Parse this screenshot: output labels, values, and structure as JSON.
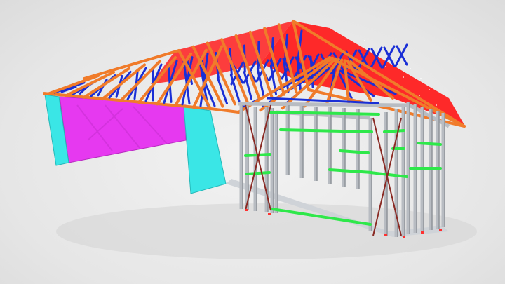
{
  "scene": {
    "subject": "house-frame-3d-render",
    "colors": {
      "background": "#e8e8e8",
      "roof_cladding": "#ff1f1f",
      "truss_chord": "#f07b2a",
      "truss_web": "#1a2fd6",
      "wall_panel_magenta": "#e639f0",
      "wall_panel_cyan": "#3ae6e6",
      "steel_stud": "#b8bcc2",
      "nogging": "#2ee84a",
      "cross_brace": "#8a2a24",
      "bearer_base": "#cfd3d8"
    },
    "icons": [
      "roof-icon",
      "truss-icon",
      "wall-frame-icon",
      "brace-icon"
    ]
  }
}
